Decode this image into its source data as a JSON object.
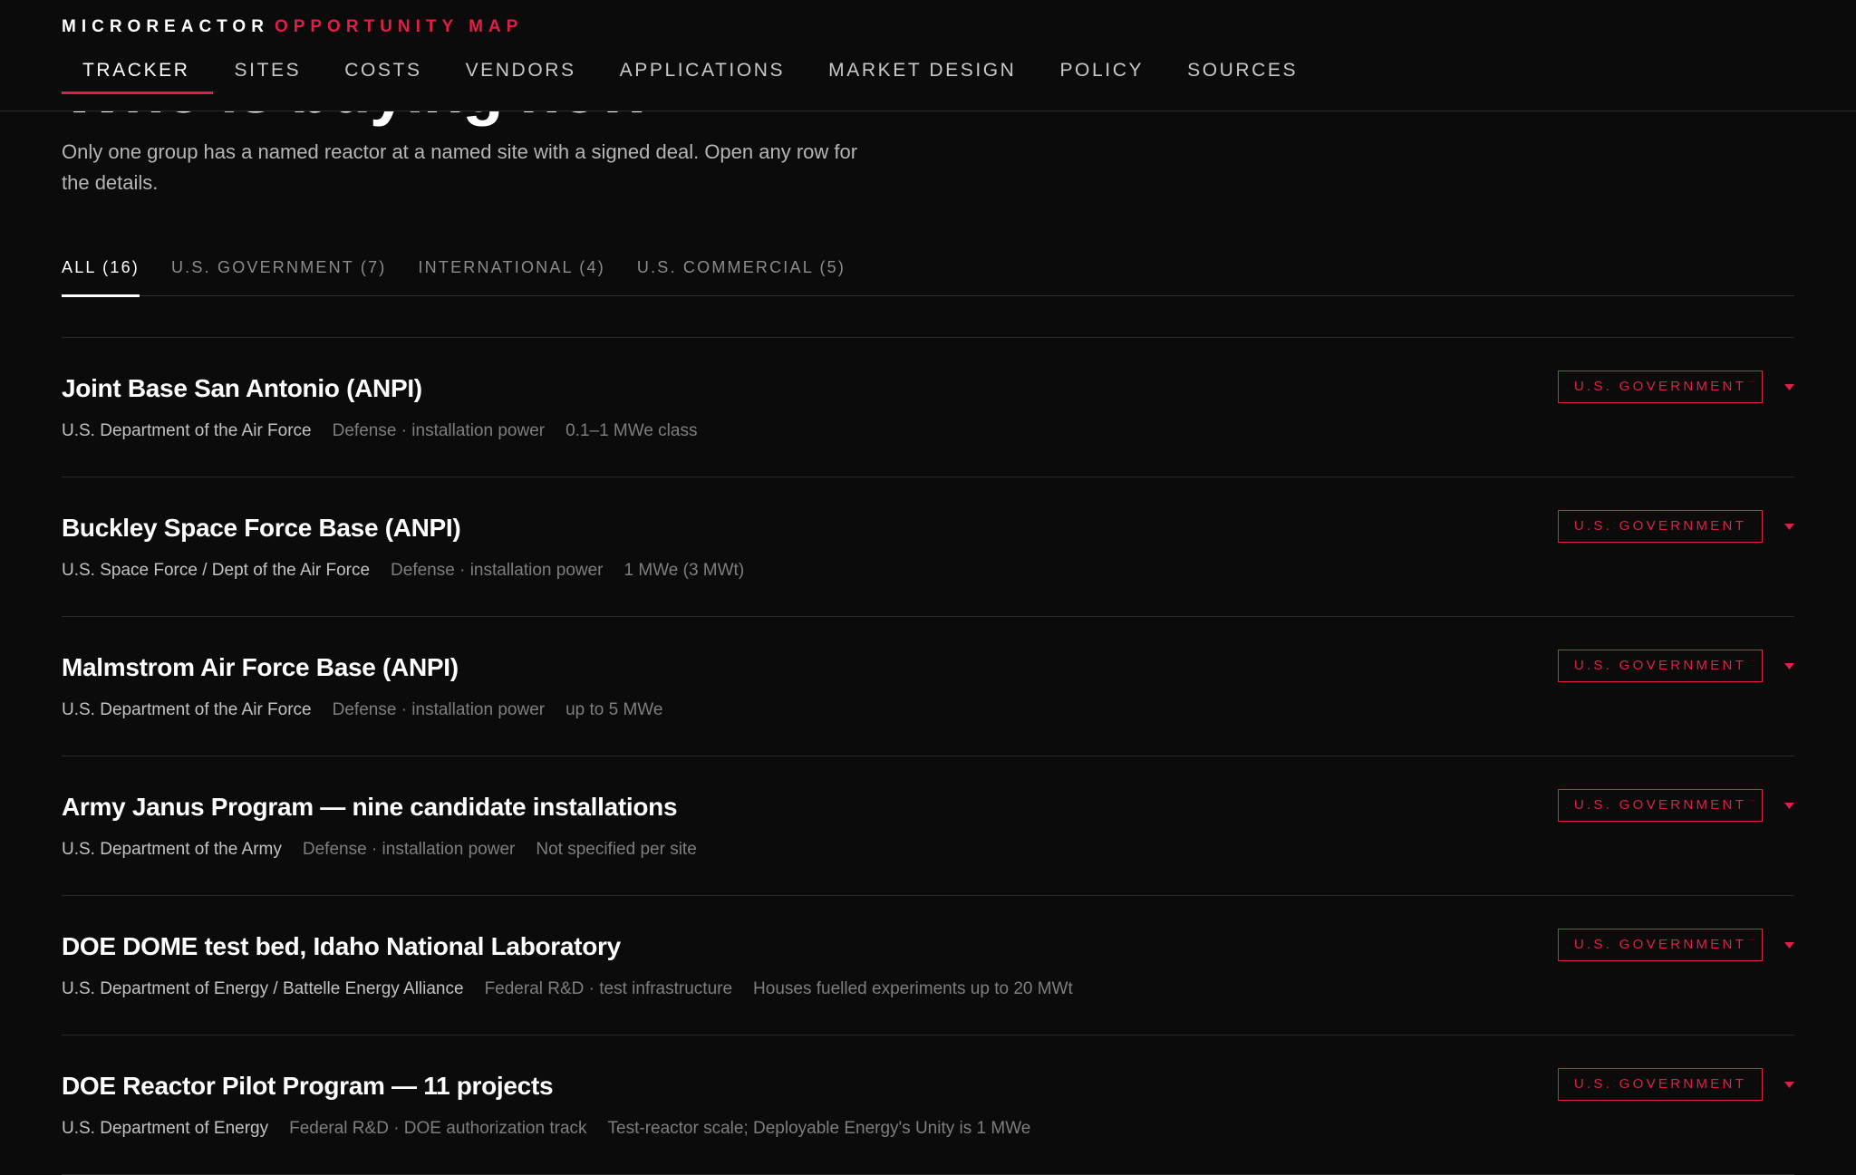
{
  "header": {
    "brand_primary": "MICROREACTOR",
    "brand_accent": "OPPORTUNITY MAP",
    "nav": [
      {
        "label": "TRACKER",
        "active": true
      },
      {
        "label": "SITES"
      },
      {
        "label": "COSTS"
      },
      {
        "label": "VENDORS"
      },
      {
        "label": "APPLICATIONS"
      },
      {
        "label": "MARKET DESIGN"
      },
      {
        "label": "POLICY"
      },
      {
        "label": "SOURCES"
      }
    ]
  },
  "page": {
    "title": "Who is buying now",
    "intro": "Only one group has a named reactor at a named site with a signed deal. Open any row for the details."
  },
  "filters": [
    {
      "label": "ALL (16)",
      "active": true
    },
    {
      "label": "U.S. GOVERNMENT (7)"
    },
    {
      "label": "INTERNATIONAL (4)"
    },
    {
      "label": "U.S. COMMERCIAL (5)"
    }
  ],
  "buyers": [
    {
      "name": "Joint Base San Antonio (ANPI)",
      "org": "U.S. Department of the Air Force",
      "sector": "Defense · installation power",
      "size": "0.1–1 MWe class",
      "category": "U.S. GOVERNMENT"
    },
    {
      "name": "Buckley Space Force Base (ANPI)",
      "org": "U.S. Space Force / Dept of the Air Force",
      "sector": "Defense · installation power",
      "size": "1 MWe (3 MWt)",
      "category": "U.S. GOVERNMENT"
    },
    {
      "name": "Malmstrom Air Force Base (ANPI)",
      "org": "U.S. Department of the Air Force",
      "sector": "Defense · installation power",
      "size": "up to 5 MWe",
      "category": "U.S. GOVERNMENT"
    },
    {
      "name": "Army Janus Program — nine candidate installations",
      "org": "U.S. Department of the Army",
      "sector": "Defense · installation power",
      "size": "Not specified per site",
      "category": "U.S. GOVERNMENT"
    },
    {
      "name": "DOE DOME test bed, Idaho National Laboratory",
      "org": "U.S. Department of Energy / Battelle Energy Alliance",
      "sector": "Federal R&D · test infrastructure",
      "size": "Houses fuelled experiments up to 20 MWt",
      "category": "U.S. GOVERNMENT"
    },
    {
      "name": "DOE Reactor Pilot Program — 11 projects",
      "org": "U.S. Department of Energy",
      "sector": "Federal R&D · DOE authorization track",
      "size": "Test-reactor scale; Deployable Energy's Unity is 1 MWe",
      "category": "U.S. GOVERNMENT"
    }
  ],
  "colors": {
    "background": "#0b0b0b",
    "accent": "#e11d48",
    "text": "#ffffff",
    "muted": "#7e7e7e"
  },
  "icons": {
    "row_toggle": "chevron-down-icon"
  }
}
